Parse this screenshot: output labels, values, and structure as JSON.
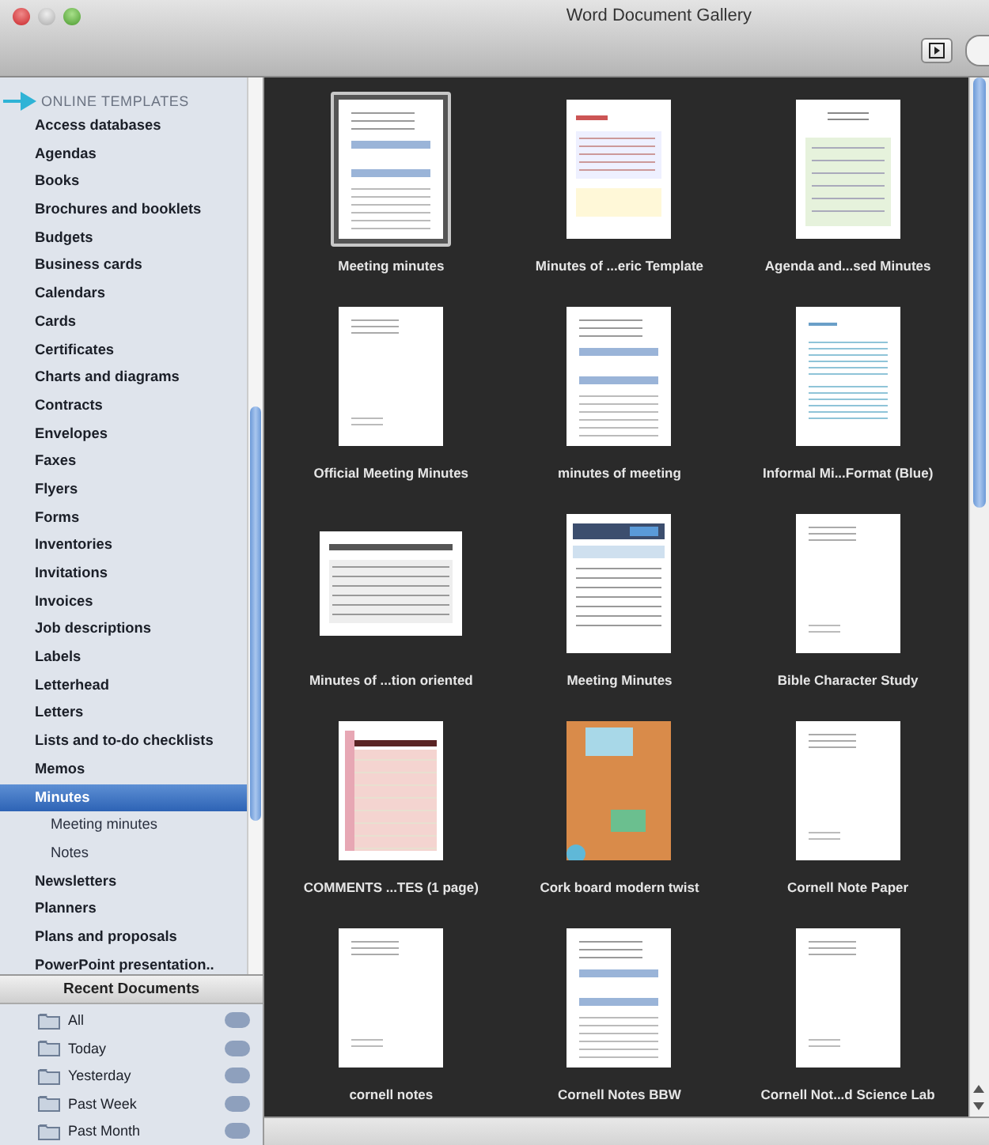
{
  "window": {
    "title": "Word Document Gallery"
  },
  "sidebar": {
    "section_header": "ONLINE TEMPLATES",
    "items": [
      {
        "label": "Access databases",
        "selected": false
      },
      {
        "label": "Agendas",
        "selected": false
      },
      {
        "label": "Books",
        "selected": false
      },
      {
        "label": "Brochures and booklets",
        "selected": false
      },
      {
        "label": "Budgets",
        "selected": false
      },
      {
        "label": "Business cards",
        "selected": false
      },
      {
        "label": "Calendars",
        "selected": false
      },
      {
        "label": "Cards",
        "selected": false
      },
      {
        "label": "Certificates",
        "selected": false
      },
      {
        "label": "Charts and diagrams",
        "selected": false
      },
      {
        "label": "Contracts",
        "selected": false
      },
      {
        "label": "Envelopes",
        "selected": false
      },
      {
        "label": "Faxes",
        "selected": false
      },
      {
        "label": "Flyers",
        "selected": false
      },
      {
        "label": "Forms",
        "selected": false
      },
      {
        "label": "Inventories",
        "selected": false
      },
      {
        "label": "Invitations",
        "selected": false
      },
      {
        "label": "Invoices",
        "selected": false
      },
      {
        "label": "Job descriptions",
        "selected": false
      },
      {
        "label": "Labels",
        "selected": false
      },
      {
        "label": "Letterhead",
        "selected": false
      },
      {
        "label": "Letters",
        "selected": false
      },
      {
        "label": "Lists and to-do checklists",
        "selected": false
      },
      {
        "label": "Memos",
        "selected": false
      },
      {
        "label": "Minutes",
        "selected": true,
        "children": [
          {
            "label": "Meeting minutes",
            "selected": false
          },
          {
            "label": "Notes",
            "selected": false
          }
        ]
      },
      {
        "label": "Newsletters",
        "selected": false
      },
      {
        "label": "Planners",
        "selected": false
      },
      {
        "label": "Plans and proposals",
        "selected": false
      },
      {
        "label": "PowerPoint presentation..",
        "selected": false
      }
    ]
  },
  "recent": {
    "header": "Recent Documents",
    "items": [
      {
        "label": "All"
      },
      {
        "label": "Today"
      },
      {
        "label": "Yesterday"
      },
      {
        "label": "Past Week"
      },
      {
        "label": "Past Month"
      }
    ]
  },
  "templates": [
    {
      "name": "Meeting minutes",
      "kind": "form",
      "selected": true
    },
    {
      "name": "Minutes of ...eric Template",
      "kind": "color-form",
      "selected": false
    },
    {
      "name": "Agenda and...sed Minutes",
      "kind": "green-form",
      "selected": false
    },
    {
      "name": "Official Meeting Minutes",
      "kind": "plain",
      "selected": false
    },
    {
      "name": "minutes of meeting",
      "kind": "form",
      "selected": false
    },
    {
      "name": "Informal Mi...Format (Blue)",
      "kind": "lined",
      "selected": false
    },
    {
      "name": "Minutes of ...tion oriented",
      "kind": "landscape",
      "selected": false
    },
    {
      "name": "Meeting Minutes",
      "kind": "banner",
      "selected": false
    },
    {
      "name": "Bible Character Study",
      "kind": "plain",
      "selected": false
    },
    {
      "name": "COMMENTS ...TES (1 page)",
      "kind": "pink",
      "selected": false
    },
    {
      "name": "Cork board modern twist",
      "kind": "cork",
      "selected": false
    },
    {
      "name": "Cornell Note Paper",
      "kind": "plain",
      "selected": false
    },
    {
      "name": "cornell notes",
      "kind": "plain",
      "selected": false
    },
    {
      "name": "Cornell Notes BBW",
      "kind": "form",
      "selected": false
    },
    {
      "name": "Cornell Not...d Science Lab",
      "kind": "plain",
      "selected": false
    }
  ]
}
